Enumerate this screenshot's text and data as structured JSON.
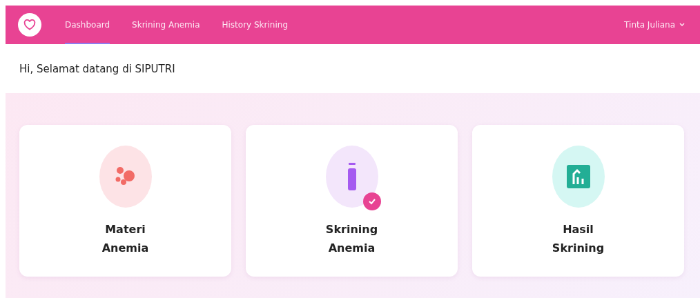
{
  "navbar": {
    "links": [
      {
        "label": "Dashboard",
        "selected": true
      },
      {
        "label": "Skrining Anemia",
        "selected": false
      },
      {
        "label": "History Skrining",
        "selected": false
      }
    ],
    "user": "Tinta Juliana"
  },
  "greeting": "Hi, Selamat datang di SIPUTRI",
  "cards": [
    {
      "kind": "blobs",
      "title": [
        "Materi",
        "Anemia"
      ],
      "checked": false
    },
    {
      "kind": "tube",
      "title": [
        "Skrining",
        "Anemia"
      ],
      "checked": true
    },
    {
      "kind": "chart",
      "title": [
        "Hasil",
        "Skrining"
      ],
      "checked": false
    }
  ]
}
